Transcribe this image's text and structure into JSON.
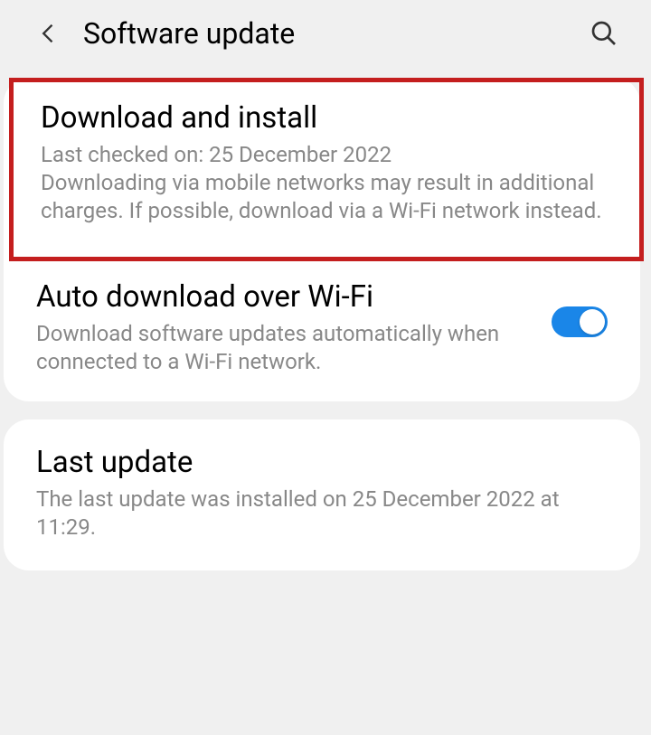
{
  "header": {
    "title": "Software update"
  },
  "section1": {
    "download": {
      "title": "Download and install",
      "lastChecked": "Last checked on: 25 December 2022",
      "warning": "Downloading via mobile networks may result in additional charges. If possible, download via a Wi-Fi network instead."
    },
    "auto": {
      "title": "Auto download over Wi-Fi",
      "desc": "Download software updates automatically when connected to a Wi-Fi network.",
      "enabled": true
    }
  },
  "section2": {
    "lastUpdate": {
      "title": "Last update",
      "desc": "The last update was installed on 25 December 2022 at 11:29."
    }
  }
}
